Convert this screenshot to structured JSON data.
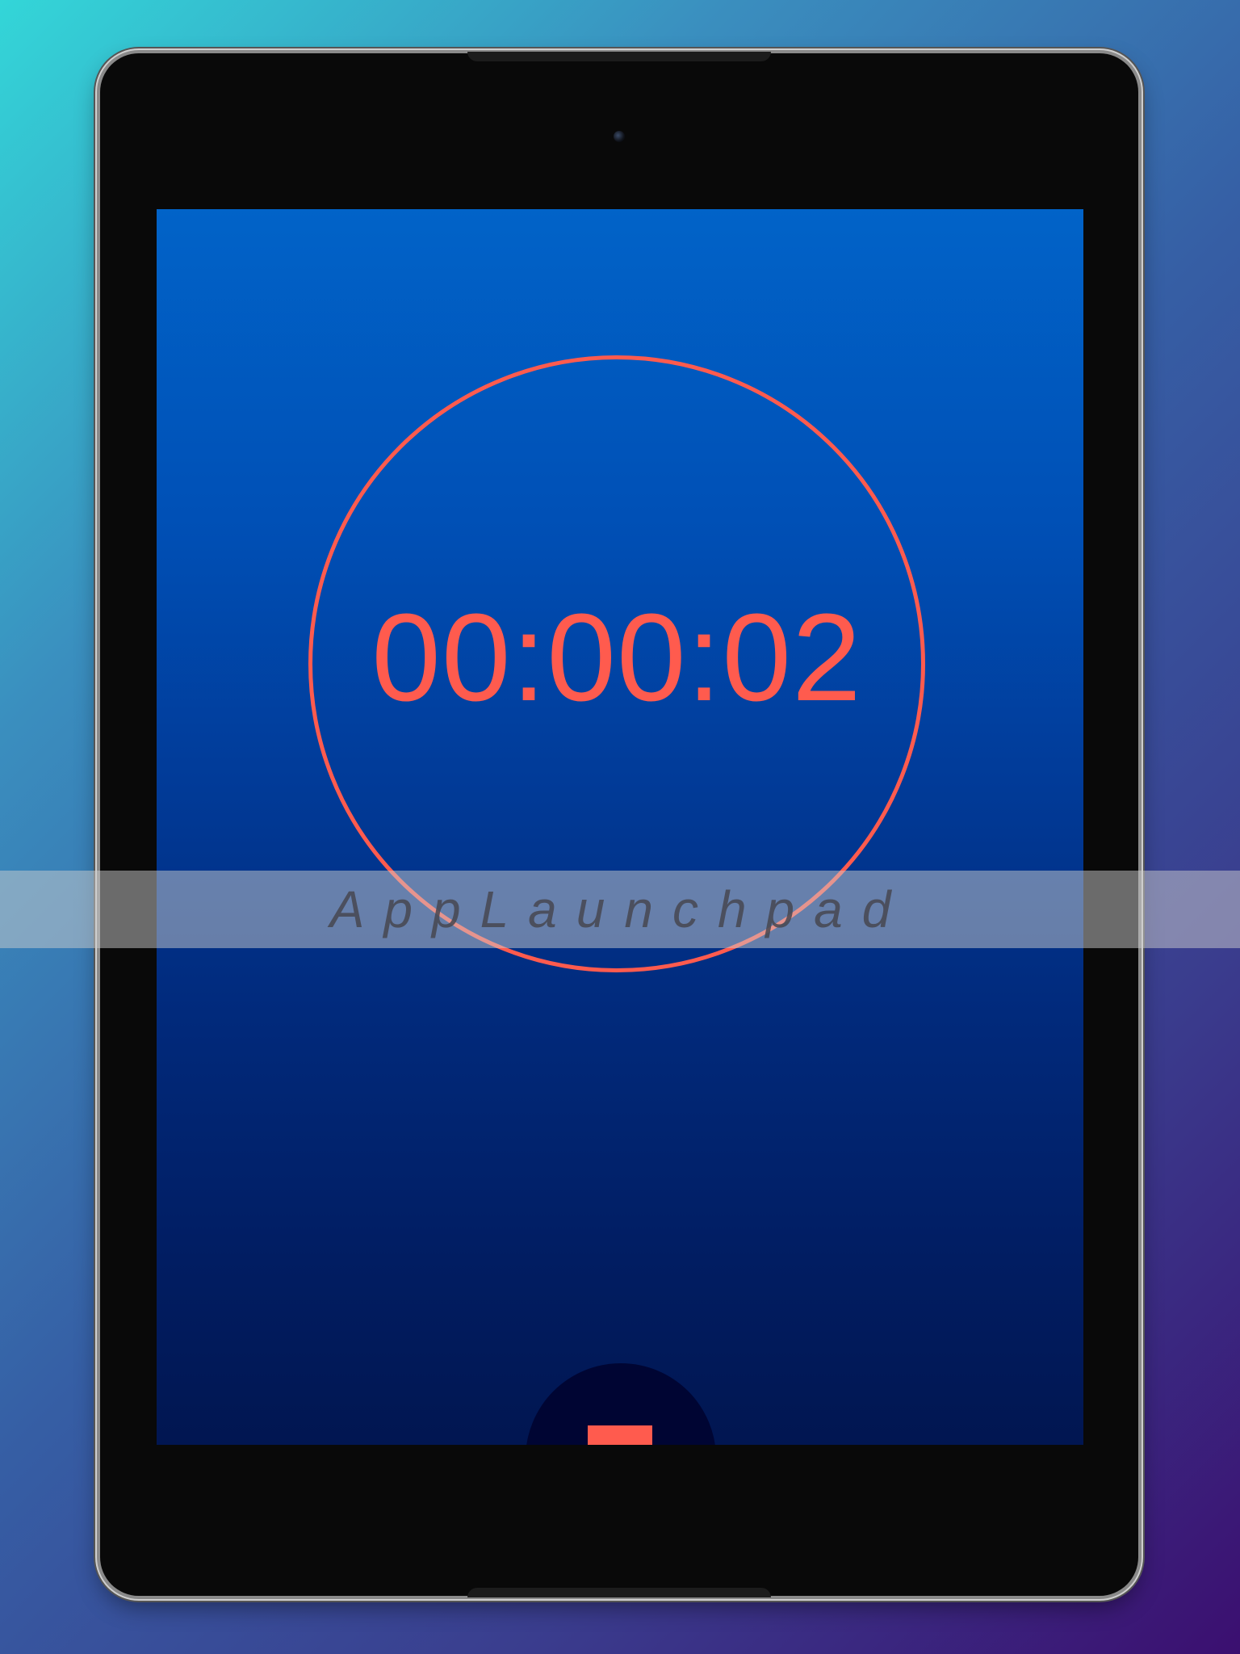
{
  "timer": {
    "display": "00:00:02"
  },
  "controls": {
    "stop_icon": "stop-square-icon"
  },
  "watermark": {
    "text": "AppLaunchpad"
  },
  "colors": {
    "accent": "#ff5b4e",
    "screen_top": "#0163c8",
    "screen_bottom": "#011651",
    "button_bg": "#000533",
    "device_bezel": "#090909"
  }
}
